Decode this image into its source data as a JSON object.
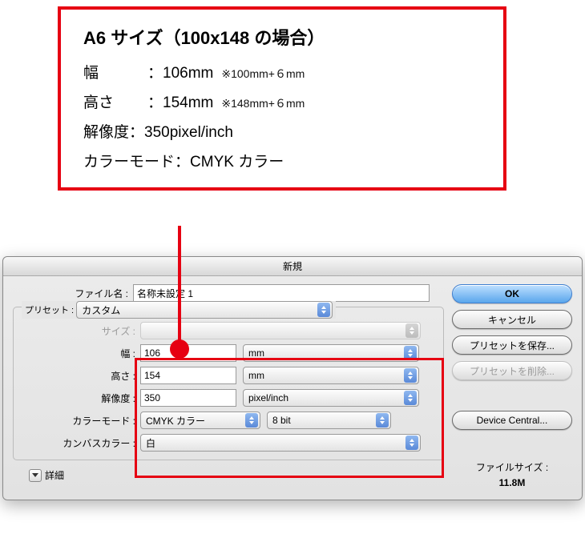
{
  "callout": {
    "title": "A6 サイズ（100x148 の場合）",
    "width_label": "幅",
    "colon": "：",
    "width_value": "106mm",
    "width_note": "※100mm+６mm",
    "height_label": "高さ",
    "height_value": "154mm",
    "height_note": "※148mm+６mm",
    "resolution_label": "解像度：",
    "resolution_value": "350pixel/inch",
    "colormode_label": "カラーモード：",
    "colormode_value": "CMYK カラー"
  },
  "dialog": {
    "title": "新規",
    "labels": {
      "filename": "ファイル名 :",
      "preset": "プリセット :",
      "size": "サイズ :",
      "width": "幅 :",
      "height": "高さ :",
      "resolution": "解像度 :",
      "colormode": "カラーモード :",
      "canvascolor": "カンバスカラー :",
      "detail": "詳細"
    },
    "values": {
      "filename": "名称未設定 1",
      "preset": "カスタム",
      "size": "",
      "width": "106",
      "width_unit": "mm",
      "height": "154",
      "height_unit": "mm",
      "resolution": "350",
      "resolution_unit": "pixel/inch",
      "colormode": "CMYK カラー",
      "depth": "8 bit",
      "canvascolor": "白"
    },
    "buttons": {
      "ok": "OK",
      "cancel": "キャンセル",
      "save_preset": "プリセットを保存...",
      "delete_preset": "プリセットを削除...",
      "device_central": "Device Central..."
    },
    "filesize": {
      "label": "ファイルサイズ :",
      "value": "11.8M"
    }
  }
}
